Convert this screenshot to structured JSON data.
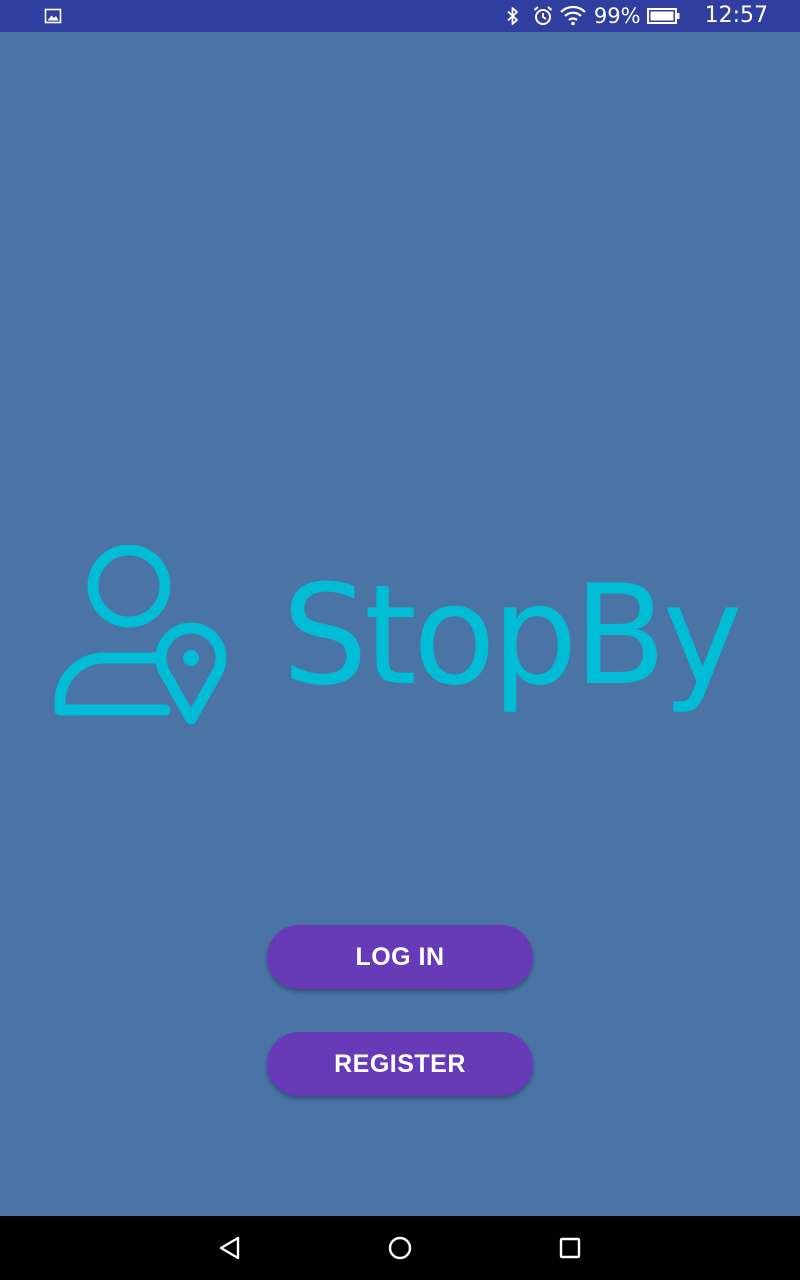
{
  "status_bar": {
    "battery_percent": "99%",
    "time": "12:57",
    "icons": [
      "image-notification-icon",
      "bluetooth-icon",
      "alarm-icon",
      "wifi-icon",
      "battery-icon"
    ]
  },
  "logo": {
    "app_name": "StopBy",
    "mark_icon": "person-location-pin-icon",
    "brand_color": "#00bcd4"
  },
  "actions": {
    "login_label": "LOG IN",
    "register_label": "REGISTER",
    "button_color": "#673ab7"
  },
  "nav_bar": {
    "icons": [
      "back-icon",
      "home-icon",
      "recents-icon"
    ]
  },
  "colors": {
    "background": "#4a73a6",
    "status_bar": "#303f9f",
    "nav_bar": "#000000"
  }
}
